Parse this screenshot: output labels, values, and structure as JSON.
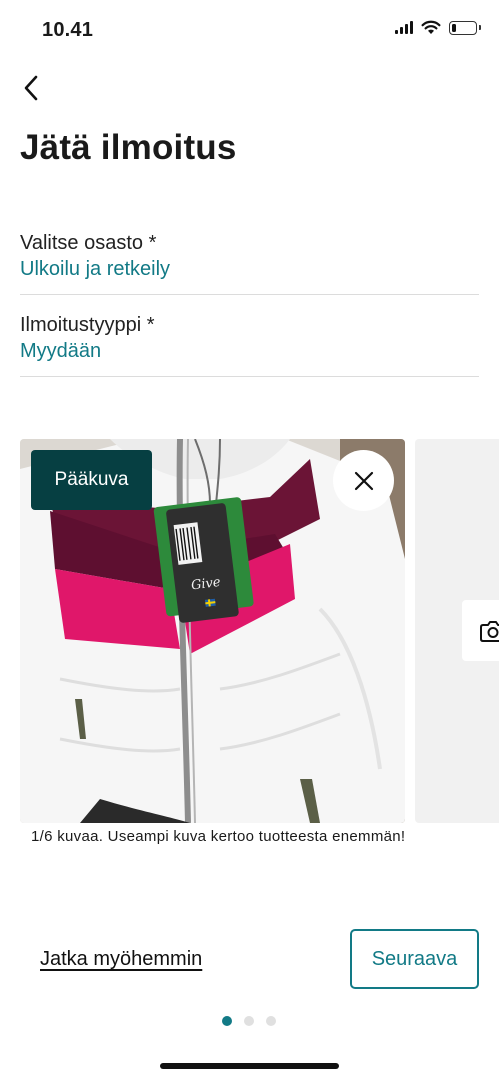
{
  "status_bar": {
    "time": "10.41",
    "battery_level": 0.2
  },
  "header": {
    "back_icon": "chevron-left-icon",
    "title": "Jätä ilmoitus"
  },
  "form": {
    "department": {
      "label": "Valitse osasto *",
      "value": "Ulkoilu ja retkeily"
    },
    "listing_type": {
      "label": "Ilmoitustyyppi *",
      "value": "Myydään"
    }
  },
  "images": {
    "main_badge": "Pääkuva",
    "remove_icon": "close-icon",
    "add_icon": "camera-icon",
    "hint": "1/6 kuvaa. Useampi kuva kertoo tuotteesta enemmän!"
  },
  "footer": {
    "later_link": "Jatka myöhemmin",
    "next_button": "Seuraava",
    "step_total": 3,
    "step_current": 1
  },
  "colors": {
    "accent": "#127a86",
    "badge_background": "#063f42"
  }
}
